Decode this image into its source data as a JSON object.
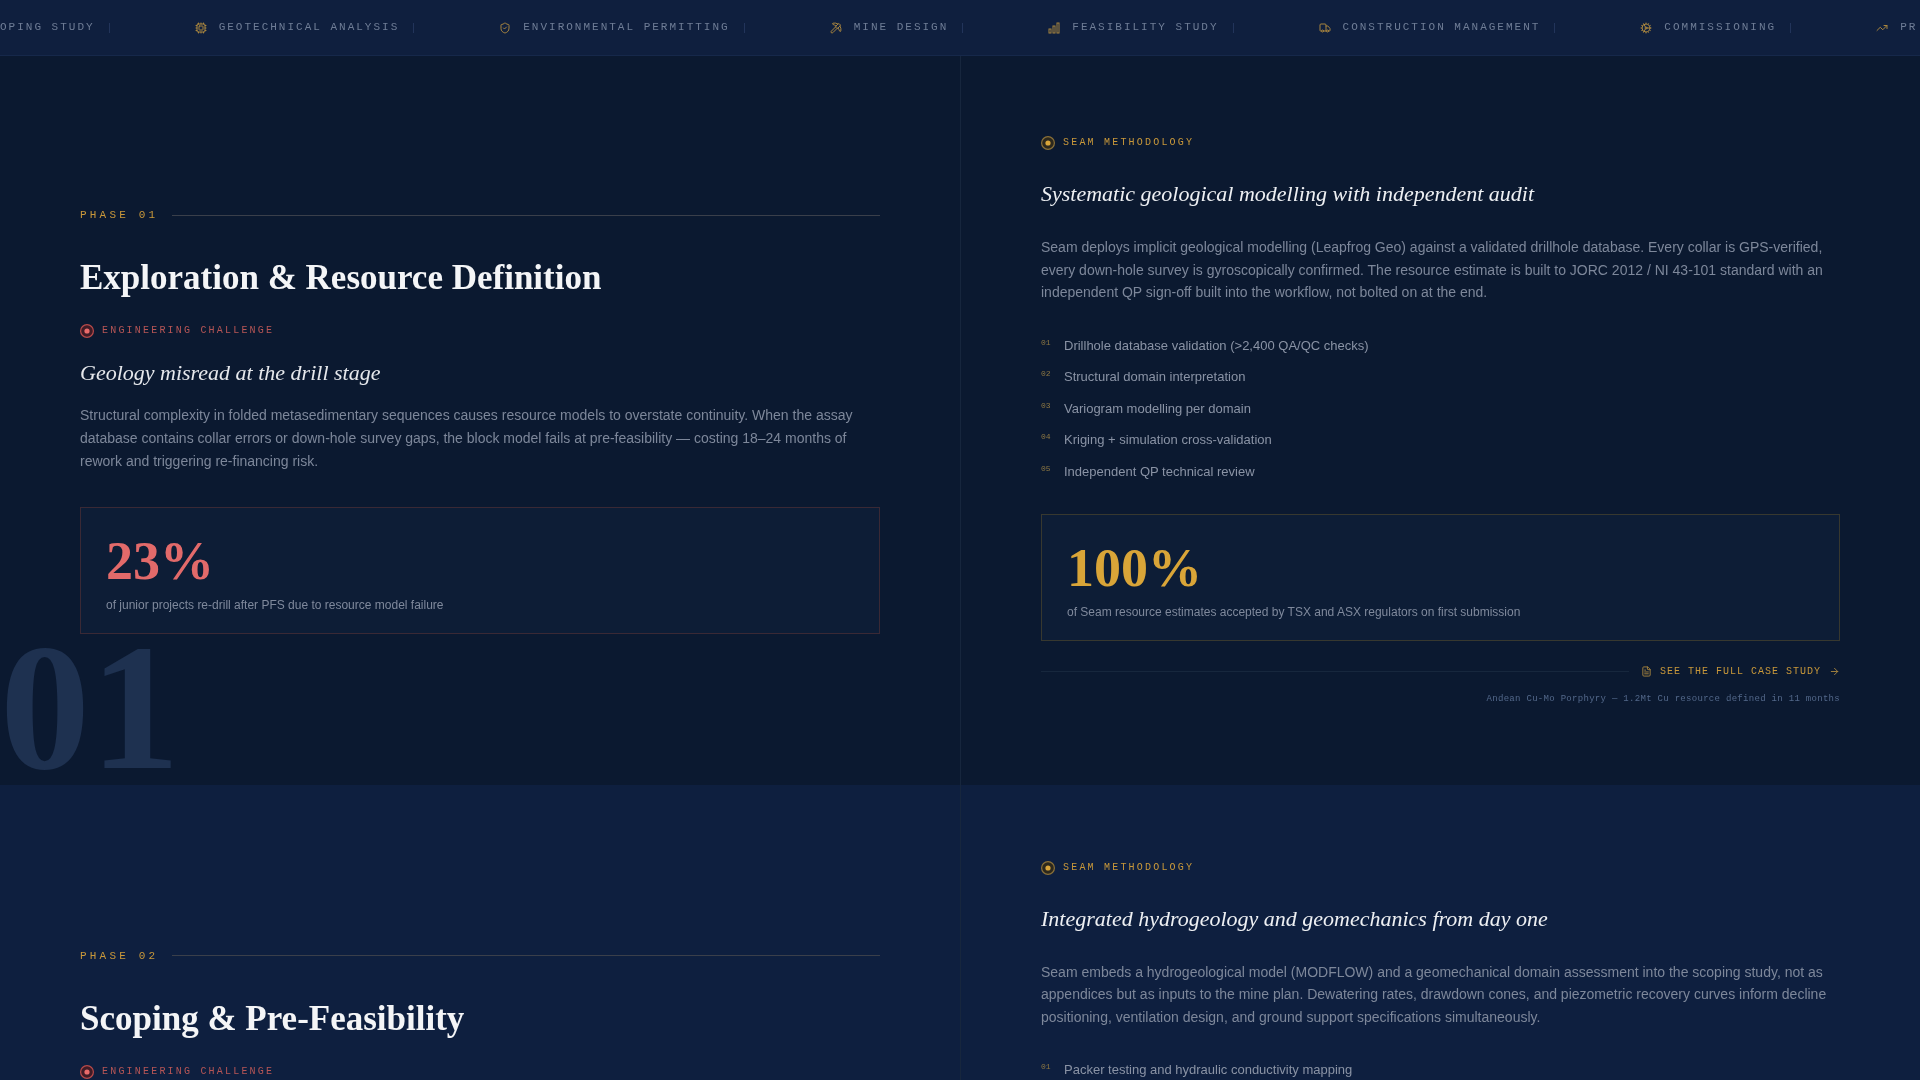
{
  "ticker": [
    {
      "label": "OPING STUDY"
    },
    {
      "label": "GEOTECHNICAL ANALYSIS"
    },
    {
      "label": "ENVIRONMENTAL PERMITTING"
    },
    {
      "label": "MINE DESIGN"
    },
    {
      "label": "FEASIBILITY STUDY"
    },
    {
      "label": "CONSTRUCTION MANAGEMENT"
    },
    {
      "label": "COMMISSIONING"
    },
    {
      "label": "PR"
    }
  ],
  "phases": [
    {
      "label": "PHASE 01",
      "backdrop_number": "01",
      "title": "Exploration & Resource Definition",
      "challenge": {
        "tag": "ENGINEERING CHALLENGE",
        "heading": "Geology misread at the drill stage",
        "body": "Structural complexity in folded metasedimentary sequences causes resource models to overstate continuity. When the assay database contains collar errors or down-hole survey gaps, the block model fails at pre-feasibility — costing 18–24 months of rework and triggering re-financing risk.",
        "stat": {
          "value": "23%",
          "caption": "of junior projects re-drill after PFS due to resource model failure"
        }
      },
      "methodology": {
        "tag": "SEAM METHODOLOGY",
        "heading": "Systematic geological modelling with independent audit",
        "body": "Seam deploys implicit geological modelling (Leapfrog Geo) against a validated drillhole database. Every collar is GPS-verified, every down-hole survey is gyroscopically confirmed. The resource estimate is built to JORC 2012 / NI 43-101 standard with an independent QP sign-off built into the workflow, not bolted on at the end.",
        "steps": [
          {
            "number": "01",
            "text": "Drillhole database validation (>2,400 QA/QC checks)"
          },
          {
            "number": "02",
            "text": "Structural domain interpretation"
          },
          {
            "number": "03",
            "text": "Variogram modelling per domain"
          },
          {
            "number": "04",
            "text": "Kriging + simulation cross-validation"
          },
          {
            "number": "05",
            "text": "Independent QP technical review"
          }
        ],
        "stat": {
          "value": "100%",
          "caption": "of Seam resource estimates accepted by TSX and ASX regulators on first submission"
        },
        "case_study_link": "SEE THE FULL CASE STUDY",
        "case_study_note": "Andean Cu-Mo Porphyry — 1.2Mt Cu resource defined in 11 months"
      }
    },
    {
      "label": "PHASE 02",
      "title": "Scoping & Pre-Feasibility",
      "challenge": {
        "tag": "ENGINEERING CHALLENGE"
      },
      "methodology": {
        "tag": "SEAM METHODOLOGY",
        "heading": "Integrated hydrogeology and geomechanics from day one",
        "body": "Seam embeds a hydrogeological model (MODFLOW) and a geomechanical domain assessment into the scoping study, not as appendices but as inputs to the mine plan. Dewatering rates, drawdown cones, and piezometric recovery curves inform decline positioning, ventilation design, and ground support specifications simultaneously.",
        "steps": [
          {
            "number": "01",
            "text": "Packer testing and hydraulic conductivity mapping"
          }
        ]
      }
    }
  ]
}
